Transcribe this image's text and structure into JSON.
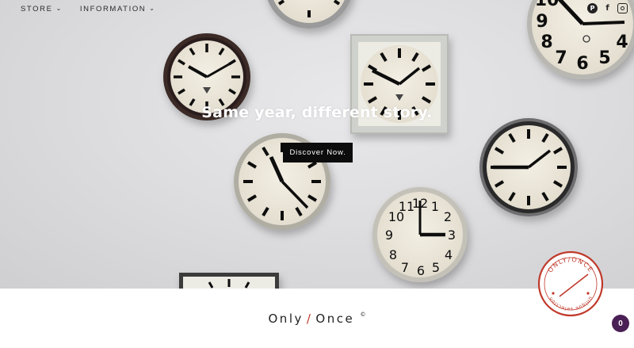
{
  "nav": {
    "items": [
      {
        "label": "STORE",
        "icon": "chevron-down-icon"
      },
      {
        "label": "INFORMATION",
        "icon": "chevron-down-icon"
      }
    ]
  },
  "social": {
    "pinterest": "P",
    "facebook": "f",
    "instagram": "instagram-icon"
  },
  "hero": {
    "tagline": "Same year, different story.",
    "cta_label": "Discover Now."
  },
  "brand": {
    "left": "Only",
    "slash": "/",
    "right": "Once",
    "mark": "©"
  },
  "seal": {
    "top_text": "ONLY/ONCE",
    "bottom_text": "unique selection"
  },
  "cart": {
    "count": "0"
  },
  "colors": {
    "accent": "#c0392b",
    "cart": "#4a1f55",
    "cta_bg": "#0c0c0c"
  }
}
